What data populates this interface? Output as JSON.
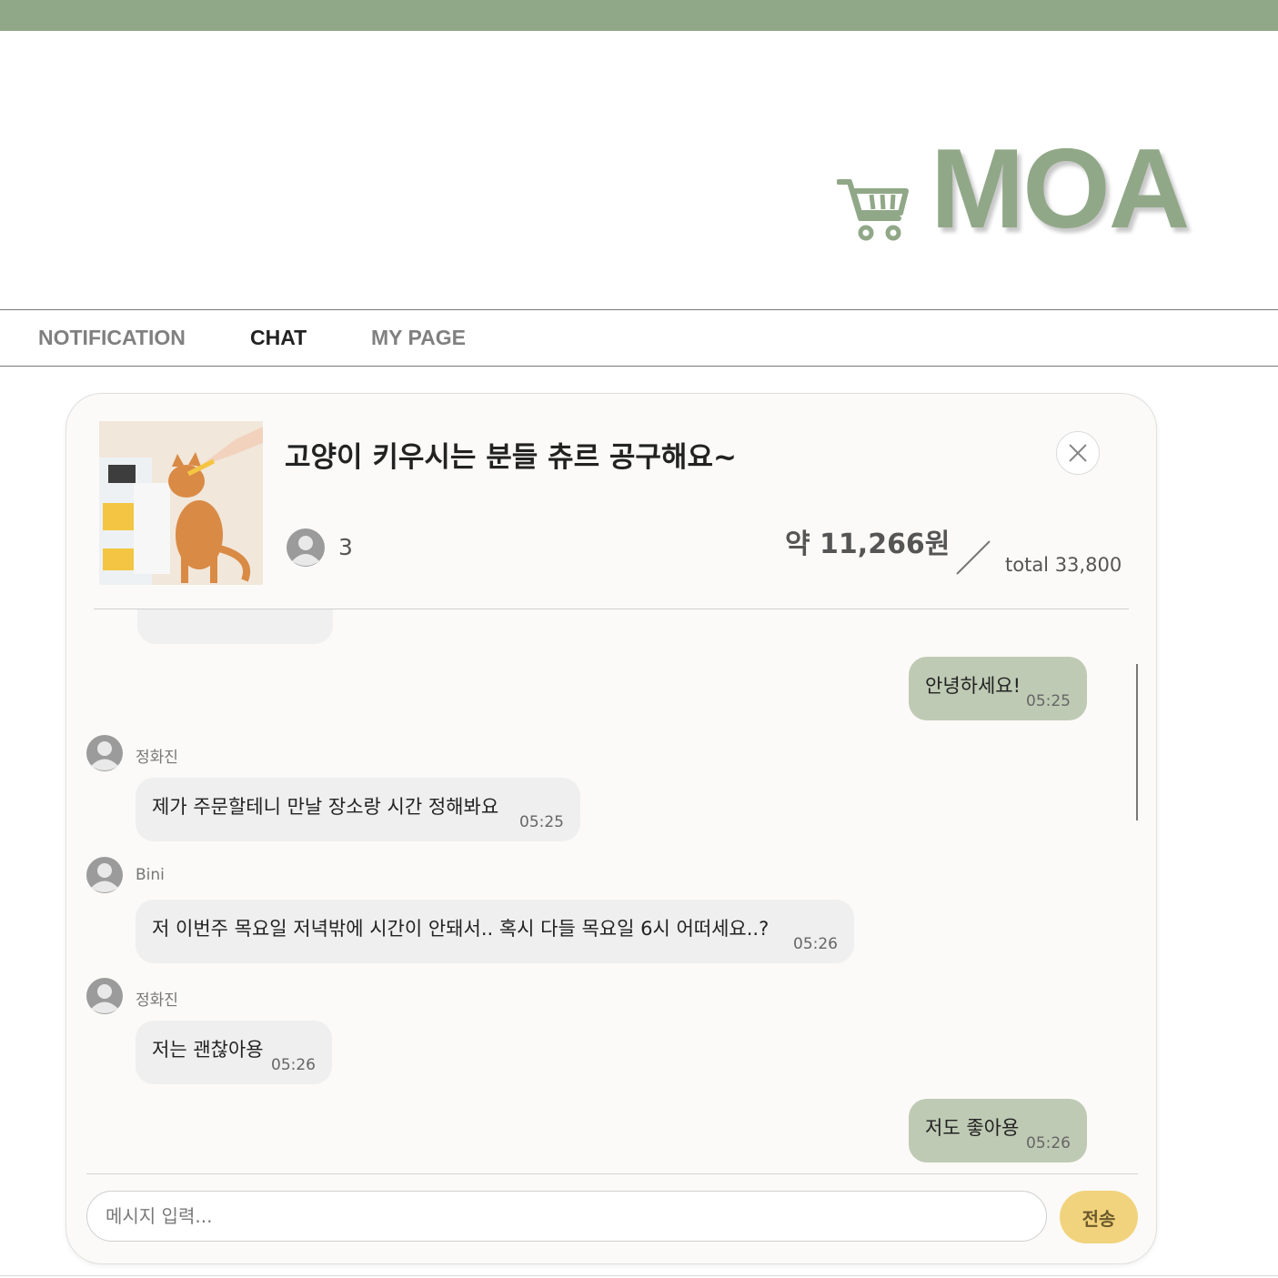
{
  "brand": {
    "logo_text": "MOA",
    "color": "#91a888"
  },
  "nav": {
    "items": [
      {
        "label": "NOTIFICATION",
        "active": false
      },
      {
        "label": "CHAT",
        "active": true
      },
      {
        "label": "MY PAGE",
        "active": false
      }
    ]
  },
  "room": {
    "title": "고양이 키우시는 분들 츄르 공구해요~",
    "member_count": "3",
    "price_per_person": "약 11,266원",
    "total": "total 33,800"
  },
  "messages": [
    {
      "from": "me",
      "text": "안녕하세요!",
      "time": "05:25"
    },
    {
      "from": "other",
      "sender": "정화진",
      "text": "제가 주문할테니 만날 장소랑 시간 정해봐요",
      "time": "05:25"
    },
    {
      "from": "other",
      "sender": "Bini",
      "text": "저 이번주 목요일 저녁밖에 시간이 안돼서.. 혹시 다들 목요일 6시 어떠세요..?",
      "time": "05:26"
    },
    {
      "from": "other",
      "sender": "정화진",
      "text": "저는 괜찮아용",
      "time": "05:26"
    },
    {
      "from": "me",
      "text": "저도 좋아용",
      "time": "05:26"
    }
  ],
  "composer": {
    "placeholder": "메시지 입력...",
    "send_label": "전송"
  },
  "colors": {
    "accent": "#91a888",
    "my_bubble": "#bfcab4",
    "other_bubble": "#efefef",
    "send_button": "#f2d37d"
  }
}
